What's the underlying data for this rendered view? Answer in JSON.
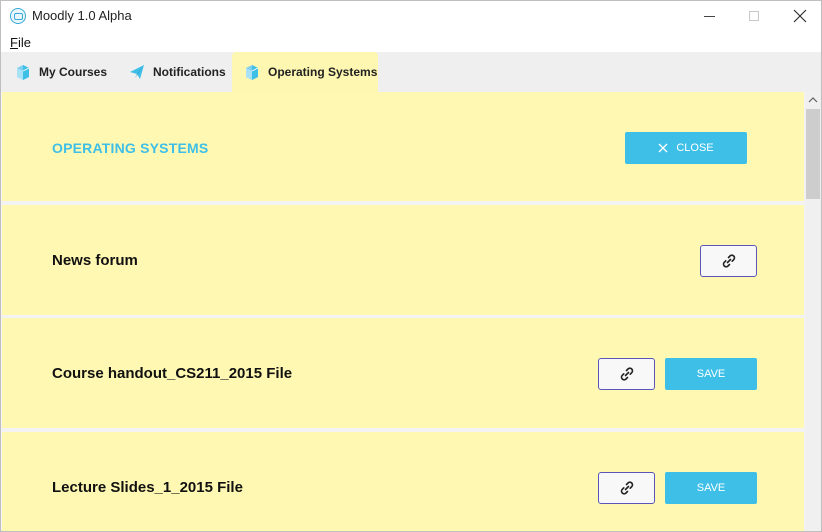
{
  "window": {
    "title": "Moodly 1.0 Alpha",
    "app_icon": "moodly-logo-icon"
  },
  "menu": {
    "file_first": "F",
    "file_rest": "ile"
  },
  "tabs": [
    {
      "label": "My Courses",
      "icon": "book-icon",
      "active": false
    },
    {
      "label": "Notifications",
      "icon": "paper-plane-icon",
      "active": false
    },
    {
      "label": "Operating Systems",
      "icon": "book-icon",
      "active": true
    }
  ],
  "course": {
    "title": "OPERATING SYSTEMS",
    "close_label": "CLOSE"
  },
  "items": [
    {
      "label": "News forum",
      "has_save": false
    },
    {
      "label": "Course handout_CS211_2015 File",
      "has_save": true,
      "save_label": "SAVE"
    },
    {
      "label": "Lecture Slides_1_2015 File",
      "has_save": true,
      "save_label": "SAVE"
    }
  ],
  "colors": {
    "accent": "#3ebfe8",
    "card_bg": "#fef8b2",
    "link_border": "#5a55b8"
  }
}
